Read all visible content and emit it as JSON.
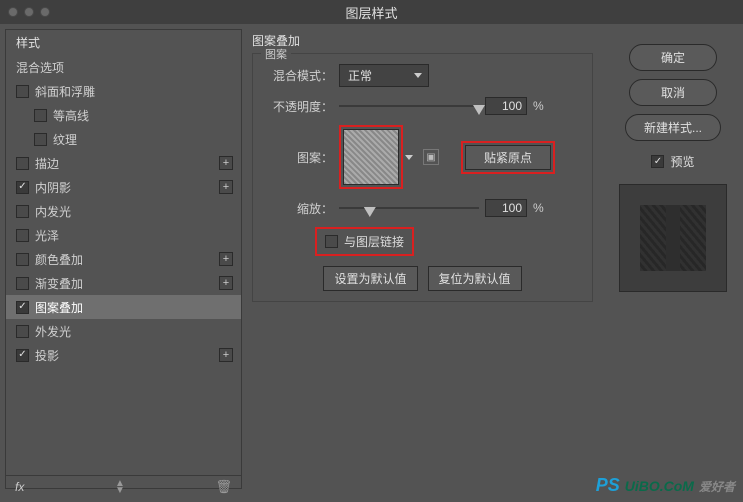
{
  "dialog": {
    "title": "图层样式"
  },
  "left": {
    "styles_header": "样式",
    "blend_options": "混合选项",
    "items": [
      {
        "label": "斜面和浮雕",
        "checked": false,
        "plus": false,
        "indent": 0
      },
      {
        "label": "等高线",
        "checked": false,
        "plus": false,
        "indent": 1
      },
      {
        "label": "纹理",
        "checked": false,
        "plus": false,
        "indent": 1
      },
      {
        "label": "描边",
        "checked": false,
        "plus": true,
        "indent": 0
      },
      {
        "label": "内阴影",
        "checked": true,
        "plus": true,
        "indent": 0
      },
      {
        "label": "内发光",
        "checked": false,
        "plus": false,
        "indent": 0
      },
      {
        "label": "光泽",
        "checked": false,
        "plus": false,
        "indent": 0
      },
      {
        "label": "颜色叠加",
        "checked": false,
        "plus": true,
        "indent": 0
      },
      {
        "label": "渐变叠加",
        "checked": false,
        "plus": true,
        "indent": 0
      },
      {
        "label": "图案叠加",
        "checked": true,
        "plus": false,
        "indent": 0,
        "selected": true
      },
      {
        "label": "外发光",
        "checked": false,
        "plus": false,
        "indent": 0
      },
      {
        "label": "投影",
        "checked": true,
        "plus": true,
        "indent": 0
      }
    ],
    "fx_label": "fx"
  },
  "middle": {
    "section": "图案叠加",
    "fieldset": "图案",
    "blend_mode_label": "混合模式：",
    "blend_mode_value": "正常",
    "opacity_label": "不透明度：",
    "opacity_value": "100",
    "pattern_label": "图案：",
    "snap_origin": "贴紧原点",
    "scale_label": "缩放：",
    "scale_value": "100",
    "link_label": "与图层链接",
    "default_btn": "设置为默认值",
    "reset_btn": "复位为默认值"
  },
  "right": {
    "ok": "确定",
    "cancel": "取消",
    "new_style": "新建样式...",
    "preview_label": "预览"
  },
  "watermark": {
    "ps": "PS",
    "site": "UiBO.CoM",
    "cn": "爱好者"
  }
}
